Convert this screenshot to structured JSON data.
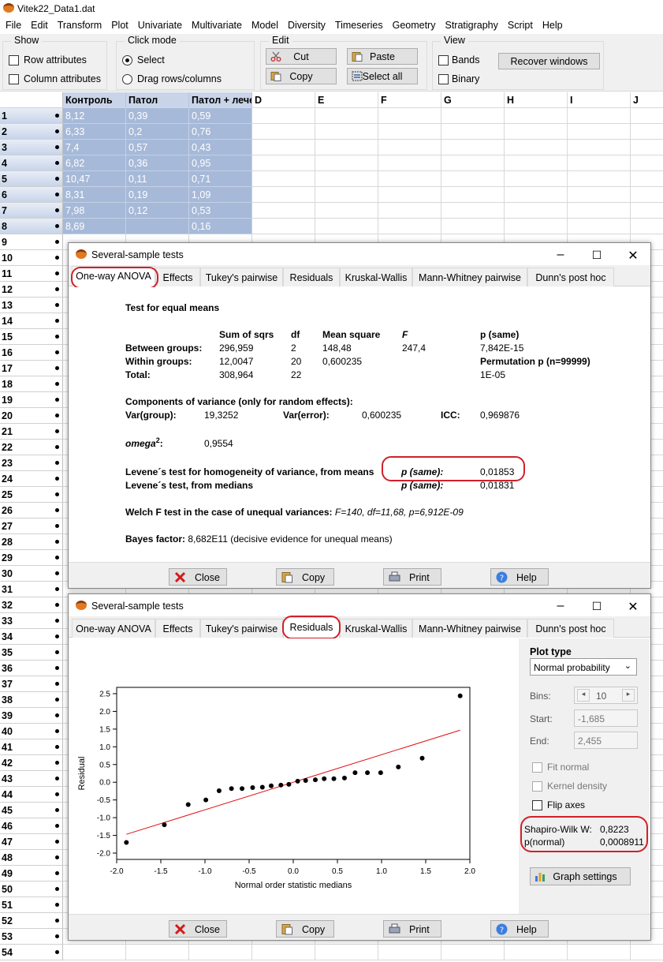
{
  "app": {
    "title": "Vitek22_Data1.dat"
  },
  "menu": [
    "File",
    "Edit",
    "Transform",
    "Plot",
    "Univariate",
    "Multivariate",
    "Model",
    "Diversity",
    "Timeseries",
    "Geometry",
    "Stratigraphy",
    "Script",
    "Help"
  ],
  "toolbar": {
    "show": {
      "title": "Show",
      "row_attributes": "Row attributes",
      "column_attributes": "Column attributes"
    },
    "click_mode": {
      "title": "Click mode",
      "select": "Select",
      "drag": "Drag rows/columns"
    },
    "edit": {
      "title": "Edit",
      "cut": "Cut",
      "paste": "Paste",
      "copy": "Copy",
      "select_all": "Select all"
    },
    "view": {
      "title": "View",
      "bands": "Bands",
      "binary": "Binary",
      "recover": "Recover windows"
    }
  },
  "grid": {
    "columns": [
      "Контроль",
      "Патол",
      "Патол + лече",
      "D",
      "E",
      "F",
      "G",
      "H",
      "I",
      "J"
    ],
    "rows": [
      [
        "8,12",
        "0,39",
        "0,59"
      ],
      [
        "6,33",
        "0,2",
        "0,76"
      ],
      [
        "7,4",
        "0,57",
        "0,43"
      ],
      [
        "6,82",
        "0,36",
        "0,95"
      ],
      [
        "10,47",
        "0,11",
        "0,71"
      ],
      [
        "8,31",
        "0,19",
        "1,09"
      ],
      [
        "7,98",
        "0,12",
        "0,53"
      ],
      [
        "8,69",
        "",
        "0,16"
      ]
    ],
    "row_count": 54
  },
  "dialog1": {
    "title": "Several-sample tests",
    "tabs": [
      "One-way ANOVA",
      "Effects",
      "Tukey's pairwise",
      "Residuals",
      "Kruskal-Wallis",
      "Mann-Whitney pairwise",
      "Dunn's post hoc"
    ],
    "heading": "Test for equal means",
    "hdr": {
      "ss": "Sum of sqrs",
      "df": "df",
      "ms": "Mean square",
      "f": "F",
      "p": "p (same)"
    },
    "between": {
      "label": "Between groups:",
      "ss": "296,959",
      "df": "2",
      "ms": "148,48",
      "f": "247,4",
      "p": "7,842E-15"
    },
    "within": {
      "label": "Within groups:",
      "ss": "12,0047",
      "df": "20",
      "ms": "0,600235",
      "perm": "Permutation p (n=99999)"
    },
    "total": {
      "label": "Total:",
      "ss": "308,964",
      "df": "22",
      "p": "1E-05"
    },
    "components": "Components of variance (only for random effects):",
    "var_group_label": "Var(group):",
    "var_group": "19,3252",
    "var_error_label": "Var(error):",
    "var_error": "0,600235",
    "icc_label": "ICC:",
    "icc": "0,969876",
    "omega_label": "omega",
    "omega_sup": "2",
    "omega_colon": ":",
    "omega": "0,9554",
    "levene_means": "Levene´s test for homogeneity of variance, from means",
    "levene_medians": "Levene´s test, from medians",
    "p_same": "p (same):",
    "levene_means_p": "0,01853",
    "levene_medians_p": "0,01831",
    "welch_label": "Welch F test in the case of unequal variances:",
    "welch_value": "F=140, df=11,68, p=6,912E-09",
    "bayes_label": "Bayes factor:",
    "bayes_value": "8,682E11 (decisive evidence for unequal means)",
    "buttons": {
      "close": "Close",
      "copy": "Copy",
      "print": "Print",
      "help": "Help"
    }
  },
  "dialog2": {
    "title": "Several-sample tests",
    "plot_type_label": "Plot type",
    "plot_type": "Normal probability",
    "bins_label": "Bins:",
    "bins": "10",
    "start_label": "Start:",
    "start": "-1,685",
    "end_label": "End:",
    "end": "2,455",
    "fit_normal": "Fit normal",
    "kernel_density": "Kernel density",
    "flip_axes": "Flip axes",
    "sw_label": "Shapiro-Wilk W:",
    "sw": "0,8223",
    "pn_label": "p(normal)",
    "pn": "0,0008911",
    "graph_settings": "Graph settings"
  },
  "chart_data": {
    "type": "scatter",
    "xlabel": "Normal order statistic medians",
    "ylabel": "Residual",
    "xlim": [
      -2.0,
      2.0
    ],
    "ylim": [
      -2.0,
      2.5
    ],
    "xticks": [
      "-2.0",
      "-1.5",
      "-1.0",
      "-0.5",
      "0.0",
      "0.5",
      "1.0",
      "1.5",
      "2.0"
    ],
    "yticks": [
      "-2.0",
      "-1.5",
      "-1.0",
      "-0.5",
      "0.0",
      "0.5",
      "1.0",
      "1.5",
      "2.0",
      "2.5"
    ],
    "points": [
      [
        -1.89,
        -1.7
      ],
      [
        -1.46,
        -1.2
      ],
      [
        -1.19,
        -0.63
      ],
      [
        -0.99,
        -0.5
      ],
      [
        -0.84,
        -0.24
      ],
      [
        -0.7,
        -0.18
      ],
      [
        -0.58,
        -0.18
      ],
      [
        -0.46,
        -0.15
      ],
      [
        -0.35,
        -0.14
      ],
      [
        -0.25,
        -0.1
      ],
      [
        -0.14,
        -0.08
      ],
      [
        -0.05,
        -0.06
      ],
      [
        0.05,
        0.03
      ],
      [
        0.14,
        0.05
      ],
      [
        0.25,
        0.07
      ],
      [
        0.35,
        0.1
      ],
      [
        0.46,
        0.1
      ],
      [
        0.58,
        0.12
      ],
      [
        0.7,
        0.27
      ],
      [
        0.84,
        0.27
      ],
      [
        0.99,
        0.27
      ],
      [
        1.19,
        0.43
      ],
      [
        1.46,
        0.68
      ],
      [
        1.89,
        2.44
      ]
    ],
    "fit_line": [
      [
        -1.89,
        -1.47
      ],
      [
        1.89,
        1.47
      ]
    ],
    "colors": {
      "points": "#000000",
      "line": "#e01010"
    }
  }
}
